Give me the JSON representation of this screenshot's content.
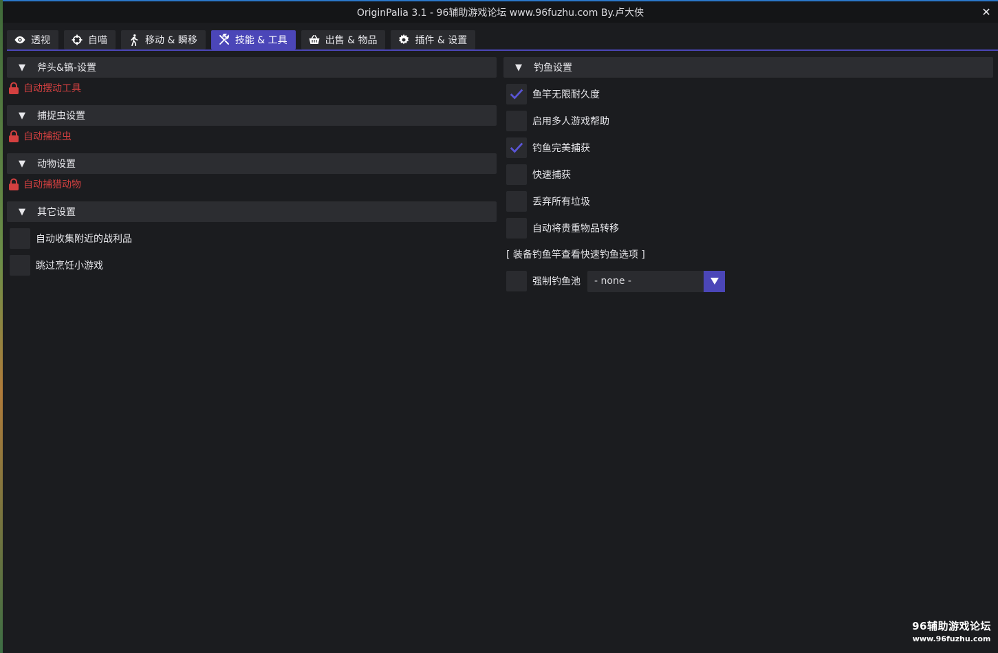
{
  "window": {
    "title": "OriginPalia 3.1 - 96辅助游戏论坛 www.96fuzhu.com By.卢大侠"
  },
  "tabs": [
    {
      "label": "透视",
      "icon": "eye-icon",
      "active": false
    },
    {
      "label": "自喵",
      "icon": "crosshair-icon",
      "active": false
    },
    {
      "label": "移动 & 瞬移",
      "icon": "walking-icon",
      "active": false
    },
    {
      "label": "技能 & 工具",
      "icon": "tools-icon",
      "active": true
    },
    {
      "label": "出售 & 物品",
      "icon": "basket-icon",
      "active": false
    },
    {
      "label": "插件 & 设置",
      "icon": "gear-icon",
      "active": false
    }
  ],
  "left": {
    "axe": {
      "header": "斧头&镐-设置",
      "locked_item": "自动摆动工具"
    },
    "bug": {
      "header": "捕捉虫设置",
      "locked_item": "自动捕捉虫"
    },
    "animal": {
      "header": "动物设置",
      "locked_item": "自动捕猎动物"
    },
    "other": {
      "header": "其它设置",
      "items": [
        {
          "label": "自动收集附近的战利品",
          "checked": false
        },
        {
          "label": "跳过烹饪小游戏",
          "checked": false
        }
      ]
    }
  },
  "right": {
    "fishing": {
      "header": "钓鱼设置",
      "items": [
        {
          "label": "鱼竿无限耐久度",
          "checked": true
        },
        {
          "label": "启用多人游戏帮助",
          "checked": false
        },
        {
          "label": "钓鱼完美捕获",
          "checked": true
        },
        {
          "label": "快速捕获",
          "checked": false
        },
        {
          "label": "丢弃所有垃圾",
          "checked": false
        },
        {
          "label": "自动将贵重物品转移",
          "checked": false
        }
      ],
      "note": "[ 装备钓鱼竿查看快速钓鱼选项 ]",
      "force_pool": {
        "label": "强制钓鱼池",
        "checked": false,
        "value": "- none -"
      }
    }
  },
  "watermark": {
    "line1": "96辅助游戏论坛",
    "line2": "www.96fuzhu.com"
  },
  "colors": {
    "accent": "#4b46b8",
    "locked": "#d34040",
    "panel": "#2c2d31",
    "background": "#1b1c1f"
  }
}
